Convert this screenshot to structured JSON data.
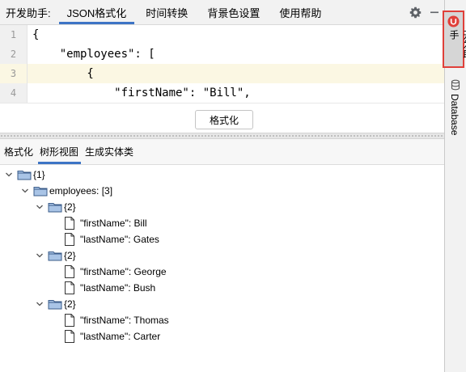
{
  "toolwindow": {
    "title": "开发助手:",
    "tabs": [
      {
        "label": "JSON格式化",
        "active": true
      },
      {
        "label": "时间转换",
        "active": false
      },
      {
        "label": "背景色设置",
        "active": false
      },
      {
        "label": "使用帮助",
        "active": false
      }
    ],
    "icons": [
      "gear-icon",
      "minimize-icon"
    ]
  },
  "editor": {
    "line_numbers": [
      "1",
      "2",
      "3",
      "4"
    ],
    "current_line": 3,
    "lines": [
      "{",
      "    \"employees\": [",
      "        {",
      "            \"firstName\": \"Bill\","
    ]
  },
  "format_button": {
    "label": "格式化"
  },
  "lower_tabs": [
    {
      "label": "格式化",
      "active": false
    },
    {
      "label": "树形视图",
      "active": true
    },
    {
      "label": "生成实体类",
      "active": false
    }
  ],
  "tree": [
    {
      "level": 0,
      "label": "{1}",
      "expandable": true,
      "icon": "folder-icon"
    },
    {
      "level": 1,
      "label": "employees: [3]",
      "expandable": true,
      "icon": "folder-icon"
    },
    {
      "level": 2,
      "label": "{2}",
      "expandable": true,
      "icon": "folder-icon"
    },
    {
      "level": 3,
      "label": "\"firstName\": Bill",
      "expandable": false,
      "icon": "file-icon"
    },
    {
      "level": 3,
      "label": "\"lastName\": Gates",
      "expandable": false,
      "icon": "file-icon"
    },
    {
      "level": 2,
      "label": "{2}",
      "expandable": true,
      "icon": "folder-icon"
    },
    {
      "level": 3,
      "label": "\"firstName\": George",
      "expandable": false,
      "icon": "file-icon"
    },
    {
      "level": 3,
      "label": "\"lastName\": Bush",
      "expandable": false,
      "icon": "file-icon"
    },
    {
      "level": 2,
      "label": "{2}",
      "expandable": true,
      "icon": "folder-icon"
    },
    {
      "level": 3,
      "label": "\"firstName\": Thomas",
      "expandable": false,
      "icon": "file-icon"
    },
    {
      "level": 3,
      "label": "\"lastName\": Carter",
      "expandable": false,
      "icon": "file-icon"
    }
  ],
  "right_toolbar": [
    {
      "label": "开发助手",
      "icon": "plugin-logo-icon",
      "active": true
    },
    {
      "label": "Database",
      "icon": "database-icon",
      "active": false
    }
  ],
  "colors": {
    "accent": "#3d74c5",
    "highlight": "#e0403a",
    "current_line": "#fbf7e3"
  }
}
